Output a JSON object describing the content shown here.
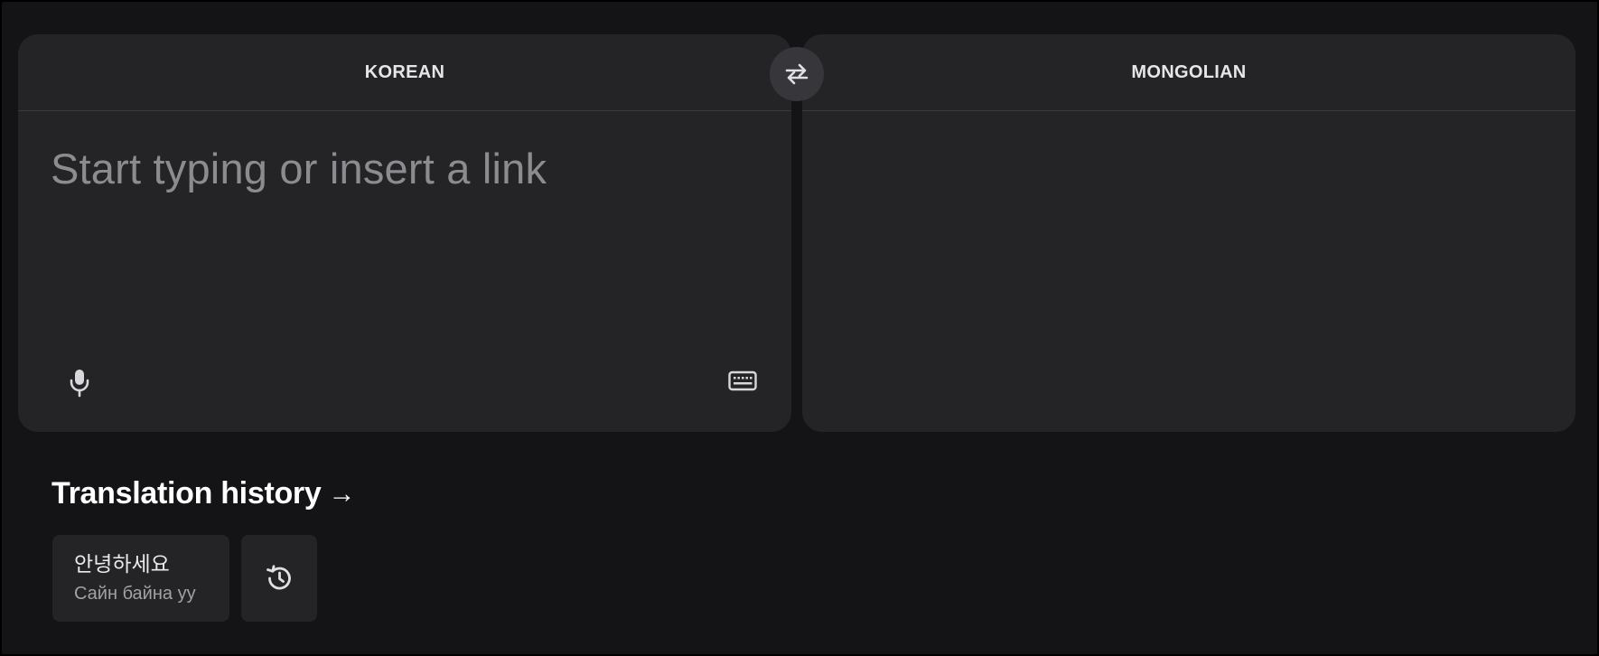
{
  "source_panel": {
    "language": "KOREAN",
    "placeholder": "Start typing or insert a link",
    "mic_icon": "microphone-icon",
    "keyboard_icon": "keyboard-icon"
  },
  "target_panel": {
    "language": "MONGOLIAN"
  },
  "swap": {
    "icon": "swap-arrows-icon"
  },
  "history": {
    "title": "Translation history",
    "arrow": "→",
    "items": [
      {
        "source": "안녕하세요",
        "translation": "Сайн байна уу"
      }
    ],
    "history_icon": "history-clock-icon"
  }
}
